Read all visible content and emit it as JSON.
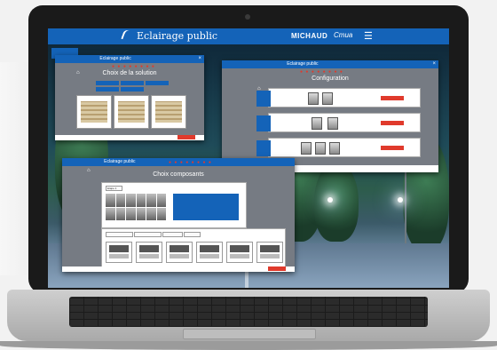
{
  "app": {
    "title": "Eclairage public",
    "brand": "MICHAUD",
    "brand2": "Cmua",
    "menu_icon": "hamburger-icon"
  },
  "win_solution": {
    "title": "Eclairage public",
    "dots": "● ● ● ● ● ● ● ●",
    "heading": "Choix de la solution"
  },
  "win_config": {
    "title": "Eclairage public",
    "dots": "● ● ● ● ● ● ● ●",
    "heading": "Configuration"
  },
  "win_comp": {
    "title": "Eclairage public",
    "dots": "● ● ● ● ● ● ● ●",
    "heading": "Choix composants",
    "tab": "Etape 1"
  },
  "colors": {
    "brand_blue": "#1463b8",
    "accent_red": "#e03a2c"
  }
}
